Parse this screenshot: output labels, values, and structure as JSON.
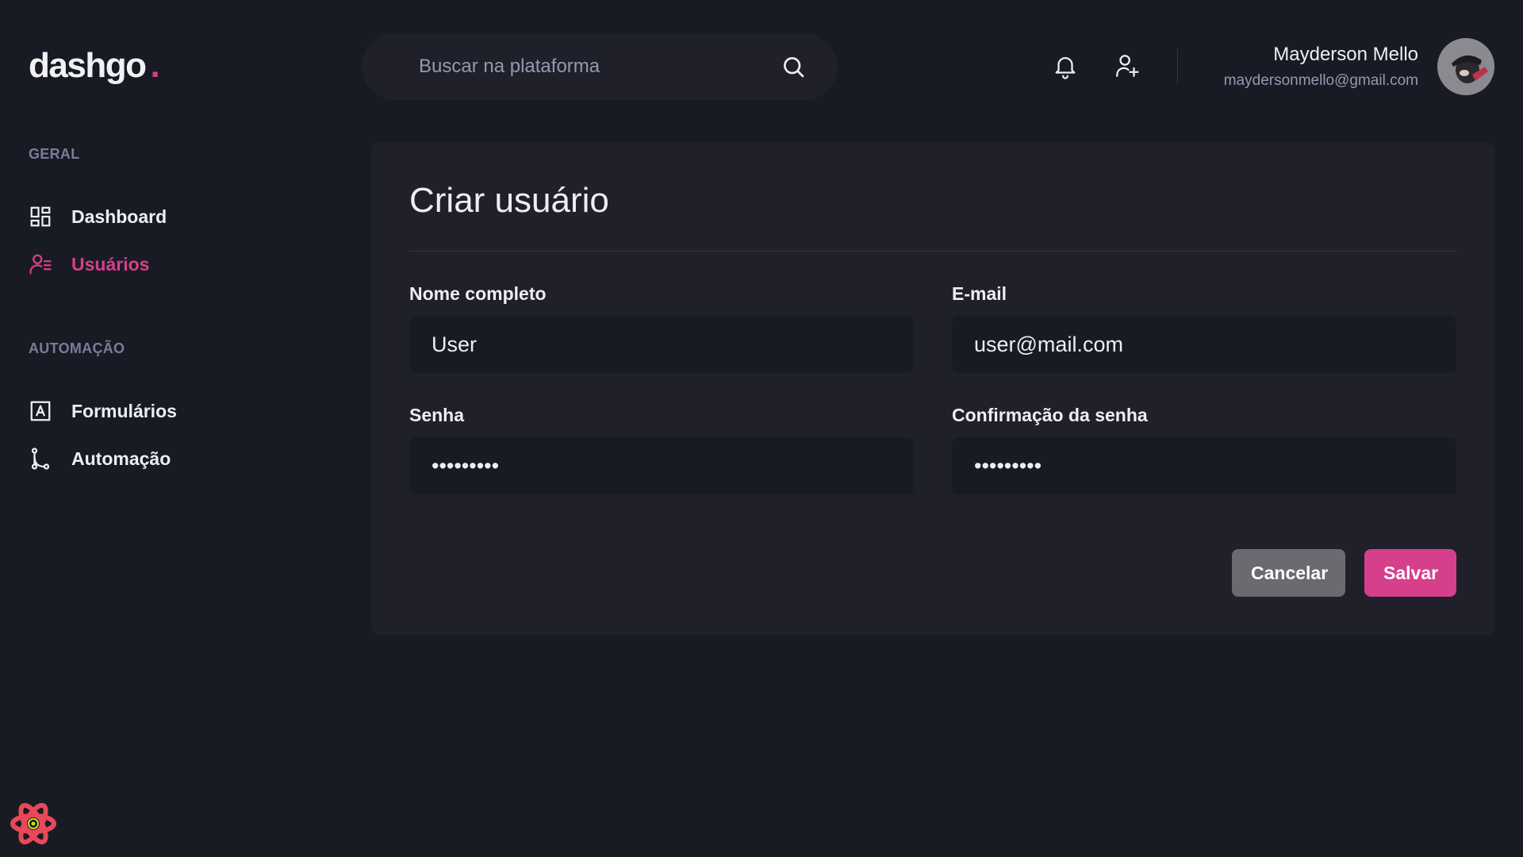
{
  "header": {
    "logo_text": "dashgo",
    "logo_dot": ".",
    "search_placeholder": "Buscar na plataforma",
    "user_name": "Mayderson Mello",
    "user_email": "maydersonmello@gmail.com"
  },
  "sidebar": {
    "sections": [
      {
        "title": "GERAL",
        "items": [
          {
            "label": "Dashboard",
            "icon": "dashboard-icon"
          },
          {
            "label": "Usuários",
            "icon": "users-icon",
            "active": true
          }
        ]
      },
      {
        "title": "AUTOMAÇÃO",
        "items": [
          {
            "label": "Formulários",
            "icon": "form-icon"
          },
          {
            "label": "Automação",
            "icon": "git-branch-icon"
          }
        ]
      }
    ]
  },
  "form": {
    "title": "Criar usuário",
    "fields": [
      {
        "label": "Nome completo",
        "value": "User",
        "type": "text"
      },
      {
        "label": "E-mail",
        "value": "user@mail.com",
        "type": "email"
      },
      {
        "label": "Senha",
        "value": "123456789",
        "type": "password"
      },
      {
        "label": "Confirmação da senha",
        "value": "123456789",
        "type": "password"
      }
    ],
    "cancel_label": "Cancelar",
    "save_label": "Salvar"
  },
  "colors": {
    "background": "#181b23",
    "panel": "#1f2029",
    "accent": "#d53f8c",
    "muted": "#797d9a",
    "cancel": "#6a6b70"
  }
}
